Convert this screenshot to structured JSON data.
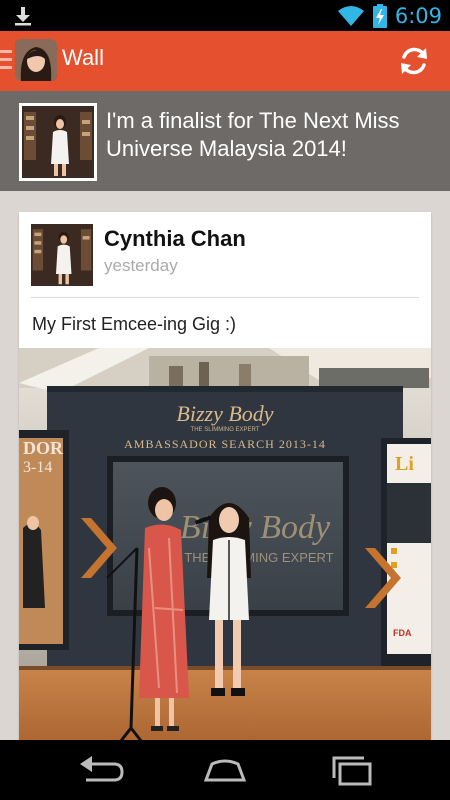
{
  "status_bar": {
    "time": "6:09",
    "icons": [
      "download-icon",
      "wifi-icon",
      "battery-charging-icon"
    ],
    "time_color": "#33b5e5"
  },
  "action_bar": {
    "title": "Wall",
    "color": "#e5502f",
    "icons": [
      "menu-indicator-icon",
      "refresh-icon"
    ]
  },
  "status_header": {
    "text": "I'm a finalist for The Next Miss Universe Malaysia 2014!"
  },
  "post": {
    "author": "Cynthia Chan",
    "time": "yesterday",
    "text": "My First Emcee-ing Gig :)",
    "photo_text": {
      "brand": "Bizzy Body",
      "tagline": "THE SLIMMING EXPERT",
      "event": "AMBASSADOR SEARCH 2013-14",
      "screen_brand": "Bizzy Body",
      "screen_tagline": "THE SLIMMING EXPERT",
      "left_panel": "DOR\n3-14",
      "right_panel_top": "Li",
      "right_badge": "FDA"
    }
  },
  "nav_bar": {
    "icons": [
      "back-icon",
      "home-icon",
      "recent-apps-icon"
    ]
  }
}
